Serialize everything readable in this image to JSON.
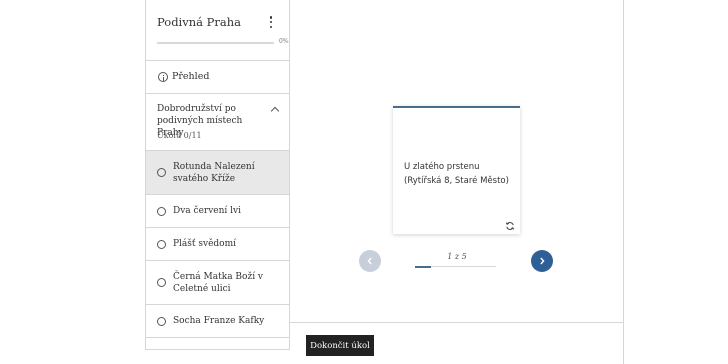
{
  "sidebar": {
    "title": "Podivná Praha",
    "progress": {
      "percent": 0,
      "label": "0%"
    },
    "overview_label": "Přehled",
    "section": {
      "title": "Dobrodružství po podivných místech Prahy",
      "subtitle": "Úkolů 0/11"
    },
    "lessons": [
      {
        "label": "Rotunda Nalezení svatého Kříže",
        "active": true
      },
      {
        "label": "Dva červení lvi",
        "active": false
      },
      {
        "label": "Plášť svědomí",
        "active": false
      },
      {
        "label": "Černá Matka Boží v Celetné ulici",
        "active": false
      },
      {
        "label": "Socha Franze Kafky",
        "active": false
      }
    ]
  },
  "card": {
    "line1": "U zlatého prstenu",
    "line2": "(Rytířská 8, Staré Město)",
    "flip_icon": "rotate-icon"
  },
  "pager": {
    "counter": "1 z 5",
    "current": 1,
    "total": 5,
    "prev_icon": "chevron-left-icon",
    "next_icon": "chevron-right-icon",
    "prev_color": "#c7cfdb",
    "next_color": "#2f5f97"
  },
  "footer": {
    "finish_label": "Dokončit úkol"
  },
  "colors": {
    "accent": "#4a6c8c",
    "dark_button": "#222222",
    "active_row": "#e8e8e8"
  }
}
